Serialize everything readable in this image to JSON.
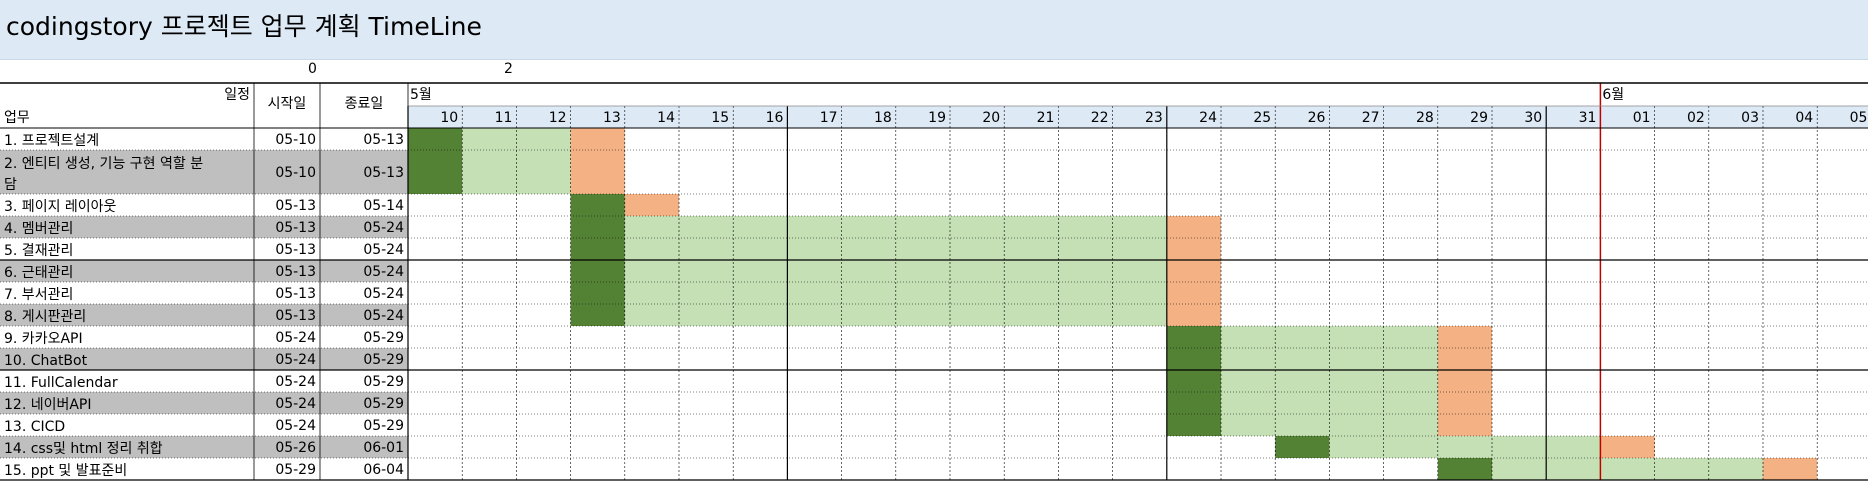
{
  "title": "codingstory 프로젝트 업무 계획 TimeLine",
  "top_numbers": [
    "0",
    "2"
  ],
  "header": {
    "schedule": "일정",
    "task": "업무",
    "start": "시작일",
    "end": "종료일",
    "month1": "5월",
    "month2": "6월"
  },
  "colors": {
    "start_day": "#548235",
    "in_progress": "#c5e0b4",
    "end_day": "#f4b183",
    "header_day_bg": "#dde9f5",
    "row_gray": "#bfbfbf",
    "today_line": "#c00000"
  },
  "chart_data": {
    "type": "gantt",
    "title": "codingstory 프로젝트 업무 계획 TimeLine",
    "days": [
      "10",
      "11",
      "12",
      "13",
      "14",
      "15",
      "16",
      "17",
      "18",
      "19",
      "20",
      "21",
      "22",
      "23",
      "24",
      "25",
      "26",
      "27",
      "28",
      "29",
      "30",
      "31",
      "01",
      "02",
      "03",
      "04",
      "05"
    ],
    "tasks": [
      {
        "name": "1. 프로젝트설계",
        "start": "05-10",
        "end": "05-13"
      },
      {
        "name": "2. 엔티티 생성, 기능 구현 역할 분담",
        "start": "05-10",
        "end": "05-13"
      },
      {
        "name": "3. 페이지 레이아웃",
        "start": "05-13",
        "end": "05-14"
      },
      {
        "name": "4. 멤버관리",
        "start": "05-13",
        "end": "05-24"
      },
      {
        "name": "5. 결재관리",
        "start": "05-13",
        "end": "05-24"
      },
      {
        "name": "6. 근태관리",
        "start": "05-13",
        "end": "05-24"
      },
      {
        "name": "7. 부서관리",
        "start": "05-13",
        "end": "05-24"
      },
      {
        "name": "8. 게시판관리",
        "start": "05-13",
        "end": "05-24"
      },
      {
        "name": "9. 카카오API",
        "start": "05-24",
        "end": "05-29"
      },
      {
        "name": "10. ChatBot",
        "start": "05-24",
        "end": "05-29"
      },
      {
        "name": "11. FullCalendar",
        "start": "05-24",
        "end": "05-29"
      },
      {
        "name": "12. 네이버API",
        "start": "05-24",
        "end": "05-29"
      },
      {
        "name": "13. CICD",
        "start": "05-24",
        "end": "05-29"
      },
      {
        "name": "14. css및 html 정리 취합",
        "start": "05-26",
        "end": "06-01"
      },
      {
        "name": "15.  ppt 및 발표준비",
        "start": "05-29",
        "end": "06-04"
      }
    ]
  }
}
